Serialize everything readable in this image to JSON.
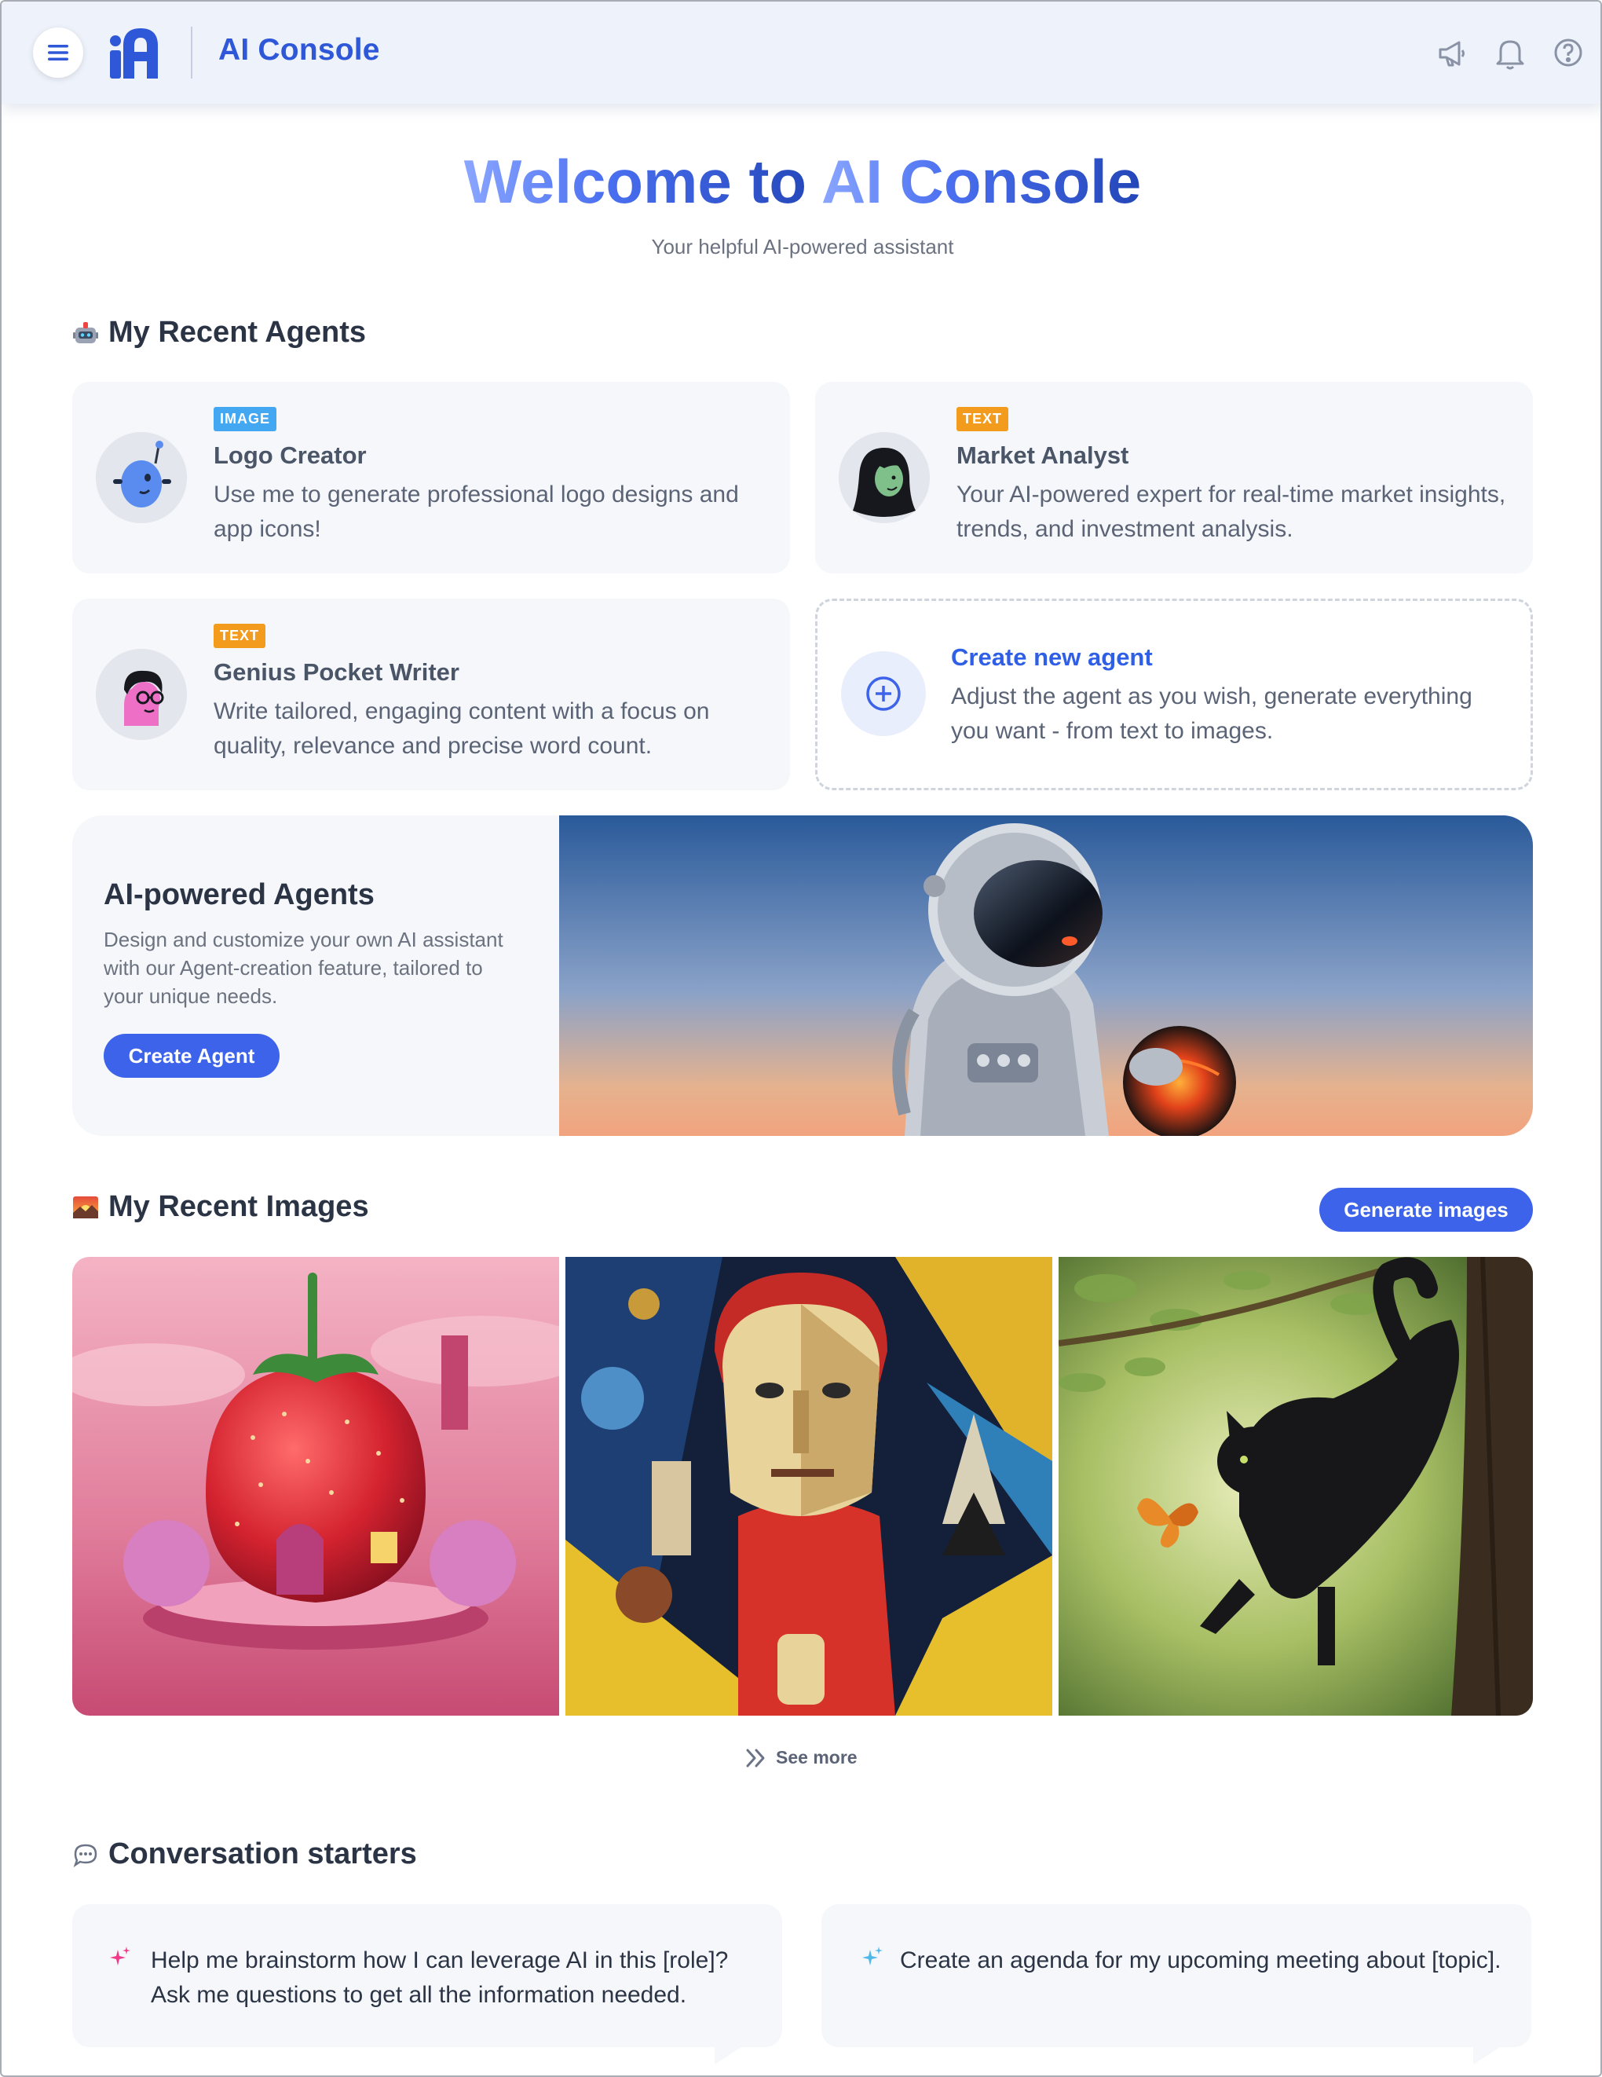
{
  "header": {
    "menu_icon": "hamburger-menu-icon",
    "app_title": "AI Console",
    "icons": [
      "megaphone-icon",
      "bell-icon",
      "help-icon"
    ],
    "accent_color": "#2f58d8"
  },
  "hero": {
    "title_part1": "Welcome to ",
    "title_part2": "AI Console",
    "subtitle": "Your helpful AI-powered assistant"
  },
  "recent_agents": {
    "emoji": "robot-emoji",
    "heading": "My Recent Agents",
    "agents": [
      {
        "badge": "IMAGE",
        "name": "Logo Creator",
        "description": "Use me to generate professional logo designs and app icons!",
        "avatar": "blue-robot-avatar"
      },
      {
        "badge": "TEXT",
        "name": "Market Analyst",
        "description": "Your AI-powered expert for real-time market insights, trends, and investment analysis.",
        "avatar": "green-woman-avatar"
      },
      {
        "badge": "TEXT",
        "name": "Genius Pocket Writer",
        "description": "Write tailored, engaging content with a focus on quality, relevance and precise word count.",
        "avatar": "glasses-man-avatar"
      }
    ],
    "create": {
      "title": "Create new agent",
      "description": "Adjust the agent as you wish, generate everything you want - from text to images."
    }
  },
  "promo": {
    "title": "AI-powered Agents",
    "description": "Design and customize your own AI assistant with our Agent-creation feature, tailored to your unique needs.",
    "button": "Create Agent",
    "image": "astronaut-with-glowing-planet"
  },
  "recent_images": {
    "emoji": "sunset-emoji",
    "heading": "My Recent Images",
    "generate_button": "Generate images",
    "images": [
      "strawberry-house",
      "cubist-portrait",
      "black-cat-butterfly"
    ],
    "see_more": "See more"
  },
  "starters": {
    "emoji": "speech-bubble-emoji",
    "heading": "Conversation starters",
    "items": [
      {
        "text": "Help me brainstorm how I can leverage AI in this [role]? Ask me questions to get all the information needed.",
        "spark_color": "#ef3b8a"
      },
      {
        "text": "Create an agenda for my upcoming meeting about [topic].",
        "spark_color": "#4fb8e8"
      }
    ]
  }
}
